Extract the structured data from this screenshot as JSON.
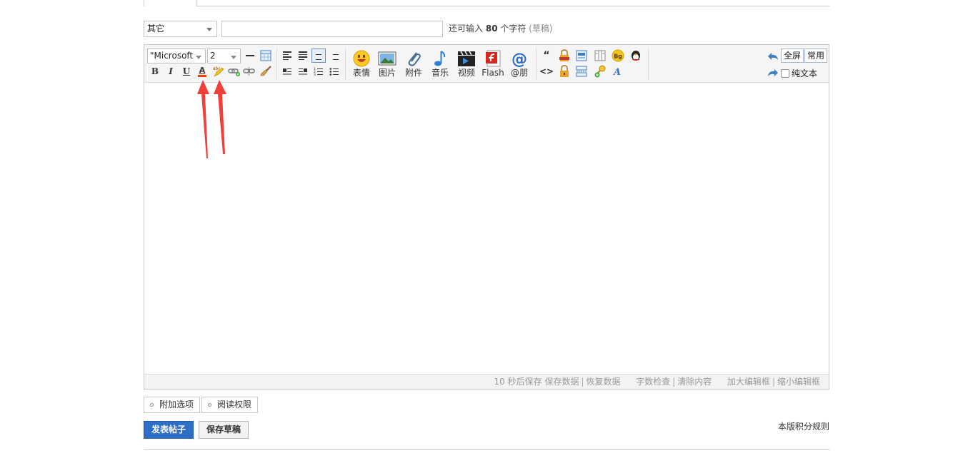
{
  "post": {
    "category_value": "其它",
    "title_value": "",
    "counter_prefix": "还可输入",
    "counter_number": "80",
    "counter_suffix": "个字符",
    "counter_draft": "(草稿)"
  },
  "toolbar": {
    "font_family": "\"Microsoft",
    "font_size": "2",
    "bold": "B",
    "italic": "I",
    "underline": "U",
    "font_color_glyph": "A",
    "quote_glyph": "“",
    "code_glyph": "<>",
    "emoji": "表情",
    "image": "图片",
    "attachment": "附件",
    "music": "音乐",
    "video": "视频",
    "flash": "Flash",
    "mention": "@朋",
    "fullscreen": "全屏",
    "common": "常用",
    "plain_text": "纯文本"
  },
  "statusbar": {
    "autosave": "10 秒后保存",
    "save_data": "保存数据",
    "restore_data": "恢复数据",
    "word_check": "字数检查",
    "clear_content": "清除内容",
    "enlarge": "加大编辑框",
    "shrink": "缩小编辑框"
  },
  "options": {
    "extra": "附加选项",
    "read_permission": "阅读权限"
  },
  "actions": {
    "submit": "发表帖子",
    "save_draft": "保存草稿",
    "credit_rules": "本版积分规则"
  },
  "colors": {
    "accent": "#2d6ec6",
    "annotation_arrow": "#f0403c"
  }
}
